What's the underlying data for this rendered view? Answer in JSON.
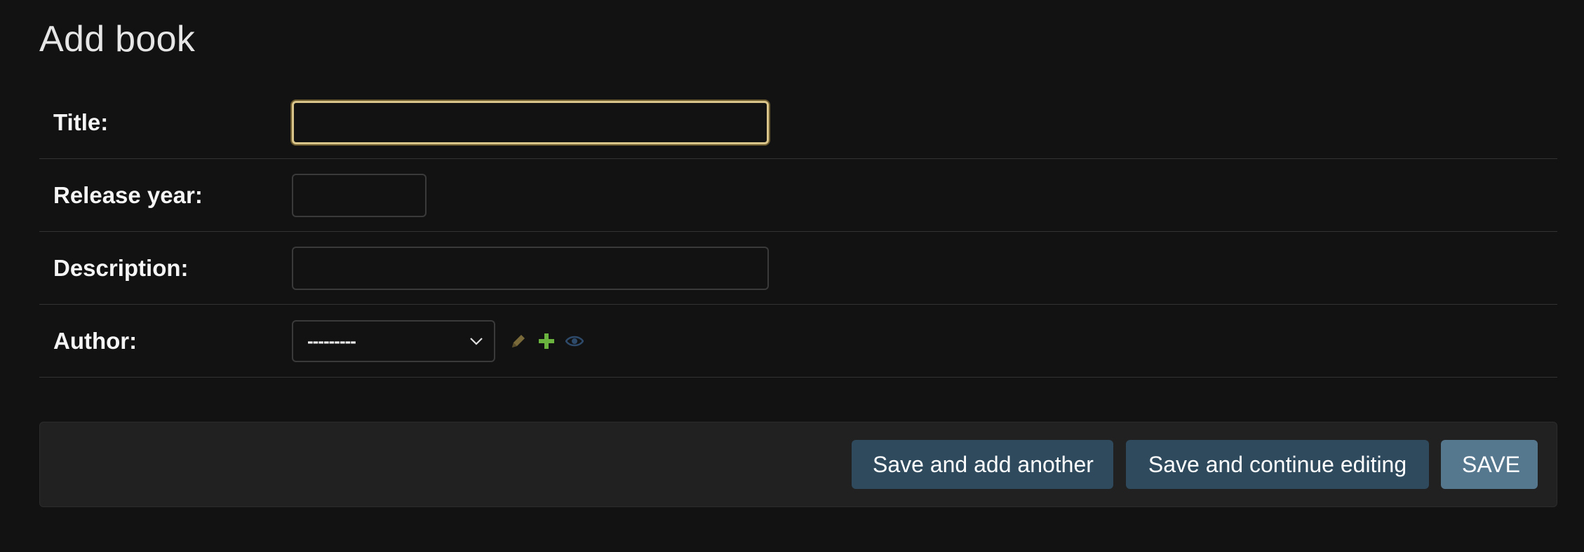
{
  "page": {
    "title": "Add book"
  },
  "form": {
    "title_field": {
      "label": "Title:",
      "value": ""
    },
    "release_year_field": {
      "label": "Release year:",
      "value": ""
    },
    "description_field": {
      "label": "Description:",
      "value": ""
    },
    "author_field": {
      "label": "Author:",
      "selected": "---------",
      "icons": [
        "pencil-icon",
        "plus-icon",
        "eye-icon"
      ]
    }
  },
  "actions": {
    "save_add_another": "Save and add another",
    "save_continue": "Save and continue editing",
    "save": "SAVE"
  },
  "colors": {
    "background": "#121212",
    "focus_border": "#d9c48a",
    "button_secondary": "#2f4a5d",
    "button_primary": "#56788f",
    "plus_icon": "#6ab33f",
    "pencil_icon": "#7a6a3a",
    "eye_icon": "#2e4a6b"
  }
}
